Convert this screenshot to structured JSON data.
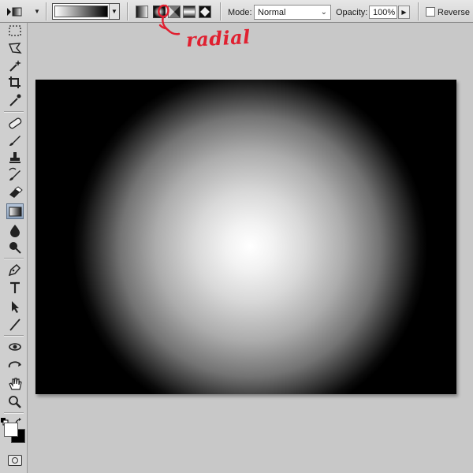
{
  "options_bar": {
    "tool_preset_icon": "gradient-tool-icon",
    "gradient_preview_colors": [
      "#ffffff",
      "#000000"
    ],
    "gradient_types": [
      {
        "name": "linear",
        "icon": "linear-gradient-icon",
        "selected": false
      },
      {
        "name": "radial",
        "icon": "radial-gradient-icon",
        "selected": true
      },
      {
        "name": "angle",
        "icon": "angle-gradient-icon",
        "selected": false
      },
      {
        "name": "reflected",
        "icon": "reflected-gradient-icon",
        "selected": false
      },
      {
        "name": "diamond",
        "icon": "diamond-gradient-icon",
        "selected": false
      }
    ],
    "mode_label": "Mode:",
    "mode_value": "Normal",
    "opacity_label": "Opacity:",
    "opacity_value": "100%",
    "reverse_label": "Reverse",
    "reverse_checked": false
  },
  "annotation": {
    "text": "radial",
    "color": "#e02030"
  },
  "toolbox": {
    "tools": [
      "rectangular-marquee-icon",
      "lasso-icon",
      "magic-wand-icon",
      "crop-icon",
      "eyedropper-icon",
      "healing-brush-icon",
      "brush-icon",
      "clone-stamp-icon",
      "history-brush-icon",
      "eraser-icon",
      "gradient-tool-icon",
      "blur-icon",
      "dodge-icon",
      "pen-icon",
      "type-icon",
      "path-selection-icon",
      "line-icon",
      "3d-rotate-icon",
      "3d-orbit-icon",
      "hand-icon",
      "zoom-icon"
    ],
    "active_tool": "gradient-tool-icon",
    "foreground_color": "#ffffff",
    "background_color": "#000000"
  },
  "canvas": {
    "fill": "radial gradient",
    "center_color": "#ffffff",
    "edge_color": "#000000"
  }
}
